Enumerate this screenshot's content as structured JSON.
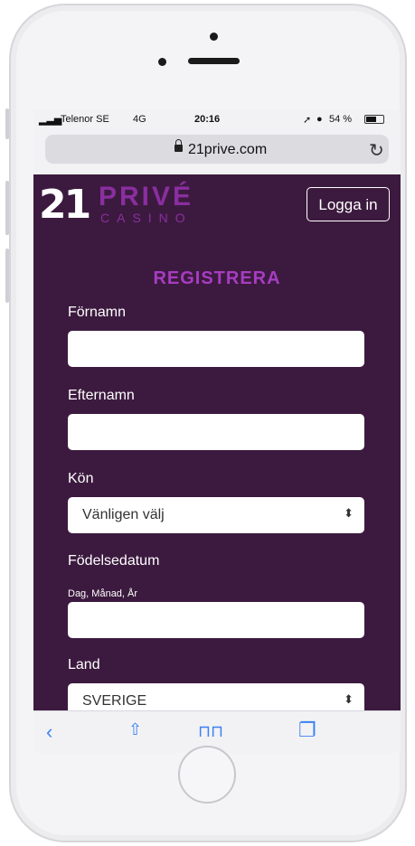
{
  "status_bar": {
    "carrier": "Telenor SE",
    "network": "4G",
    "time": "20:16",
    "battery": "54 %"
  },
  "browser": {
    "url": "21prive.com",
    "reload_icon": "reload-icon",
    "lock_icon": "lock-icon"
  },
  "site": {
    "logo_number": "21",
    "logo_brand": "PRIVÉ",
    "logo_sub": "CASINO",
    "login_label": "Logga in"
  },
  "form": {
    "title": "REGISTRERA",
    "first_name_label": "Förnamn",
    "last_name_label": "Efternamn",
    "gender_label": "Kön",
    "gender_value": "Vänligen välj",
    "dob_label": "Födelsedatum",
    "dob_hint": "Dag, Månad, År",
    "country_label": "Land",
    "country_value": "SVERIGE"
  },
  "toolbar": {
    "back_icon": "back-icon",
    "share_icon": "share-icon",
    "bookmarks_icon": "bookmarks-icon",
    "tabs_icon": "tabs-icon"
  },
  "colors": {
    "page_bg": "#3c1a3f",
    "accent": "#a73cc2",
    "ios_blue": "#3c82f0"
  }
}
